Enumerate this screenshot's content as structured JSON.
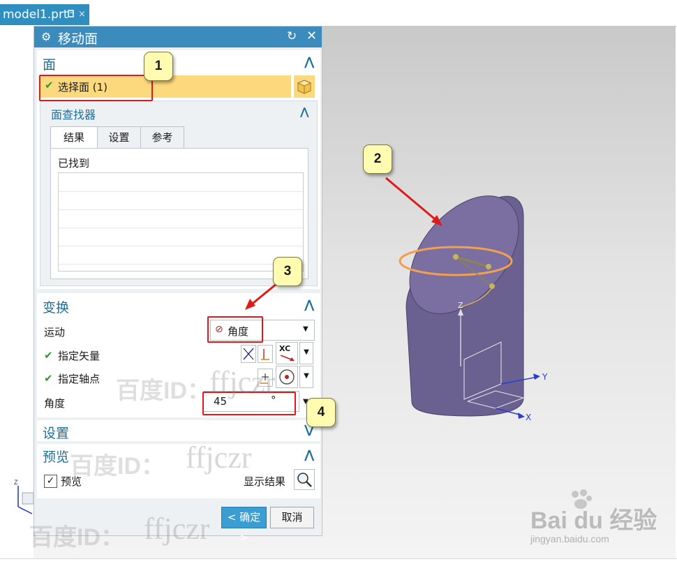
{
  "file_tab": {
    "name": "model1.prt",
    "pin_icon": "pin-icon",
    "close_glyph": "×"
  },
  "dialog": {
    "title": "移动面",
    "sections": {
      "face": {
        "title": "面",
        "select_face": "选择面 (1)",
        "finder": {
          "title": "面查找器",
          "tabs": [
            "结果",
            "设置",
            "参考"
          ],
          "found_label": "已找到"
        }
      },
      "transform": {
        "title": "变换",
        "motion_label": "运动",
        "motion_value": "角度",
        "vector_label": "指定矢量",
        "pivot_label": "指定轴点",
        "angle_label": "角度",
        "angle_value": "45",
        "angle_unit": "°",
        "xc_label": "XC"
      },
      "settings": {
        "title": "设置"
      },
      "preview": {
        "title": "预览",
        "checkbox_label": "预览",
        "show_result": "显示结果",
        "checked": true
      }
    },
    "ok_label": "< 确定 >",
    "cancel_label": "取消"
  },
  "callouts": [
    "1",
    "2",
    "3",
    "4"
  ],
  "axes": {
    "y": "Y",
    "x": "X",
    "z": "Z"
  },
  "watermark": {
    "text_a": "百度ID：",
    "text_b": "ffjczr",
    "brand": "Bai du 经验",
    "site": "jingyan.baidu.com"
  },
  "colors": {
    "titlebar": "#3b8bbd",
    "selection": "#fcd97d",
    "section_title": "#1e6f98",
    "cylinder": "#6b6191",
    "ellipse_ring": "#f0a050",
    "callout_fill": "#fffbb0",
    "callout_border": "#e01919"
  }
}
